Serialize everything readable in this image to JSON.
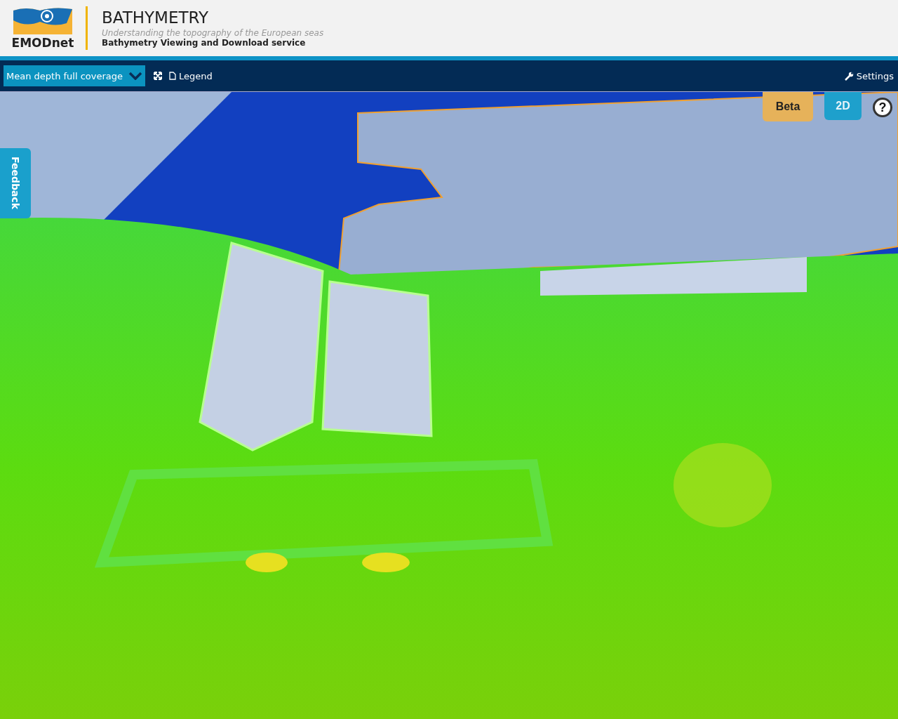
{
  "header": {
    "logo_text": "EMODnet",
    "title": "BATHYMETRY",
    "subtitle": "Understanding the topography of the European seas",
    "service": "Bathymetry Viewing and Download service"
  },
  "toolbar": {
    "layer_select": "Mean depth full coverage",
    "legend": "Legend",
    "settings": "Settings"
  },
  "map": {
    "buttons": [
      {
        "label": "Beta",
        "kind": "beta"
      },
      {
        "label": "2D",
        "kind": "view"
      },
      {
        "label": "?",
        "kind": "help"
      }
    ],
    "feedback": "Feedback"
  }
}
